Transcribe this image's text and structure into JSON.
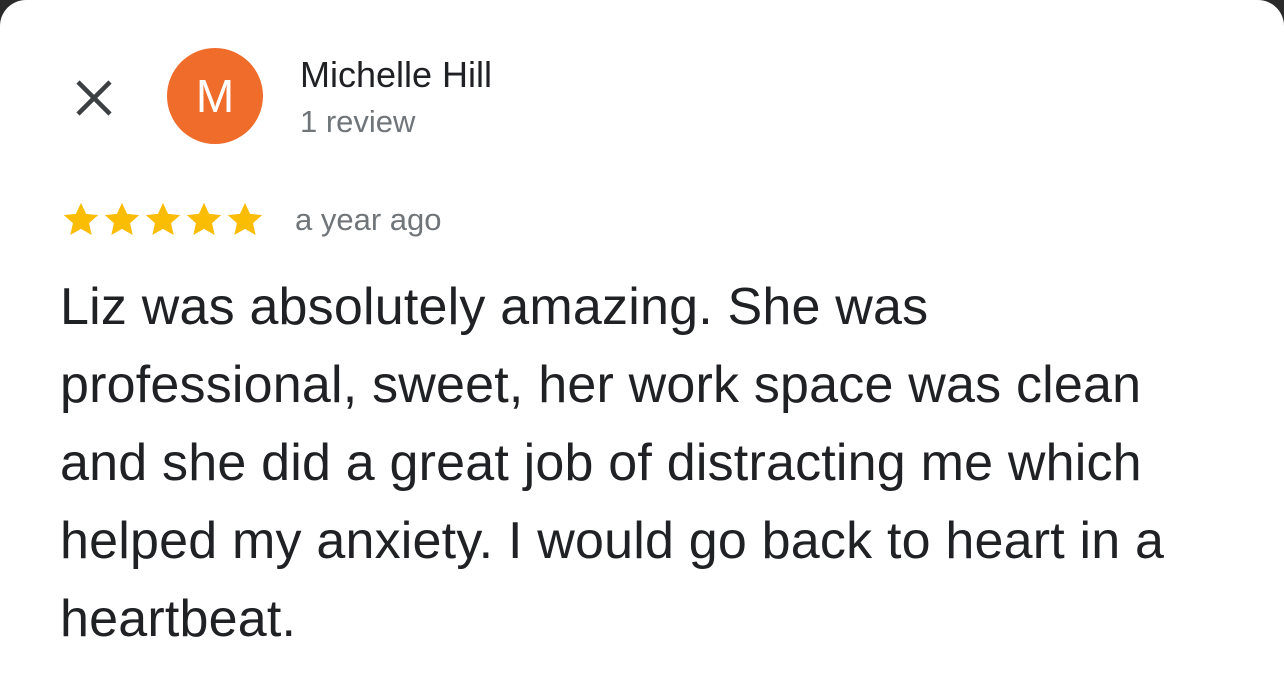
{
  "colors": {
    "avatar_bg": "#ef6c2b",
    "star": "#fbbc04",
    "primary_text": "#202124",
    "secondary_text": "#70757a"
  },
  "header": {
    "close_icon": "close-icon"
  },
  "author": {
    "avatar_letter": "M",
    "name": "Michelle Hill",
    "review_count": "1 review"
  },
  "review": {
    "rating": 5,
    "rating_max": 5,
    "date": "a year ago",
    "text": "Liz was absolutely amazing. She was professional, sweet, her work space was clean and she did a great job of distracting me which helped my anxiety. I would go back to heart in a heartbeat."
  }
}
